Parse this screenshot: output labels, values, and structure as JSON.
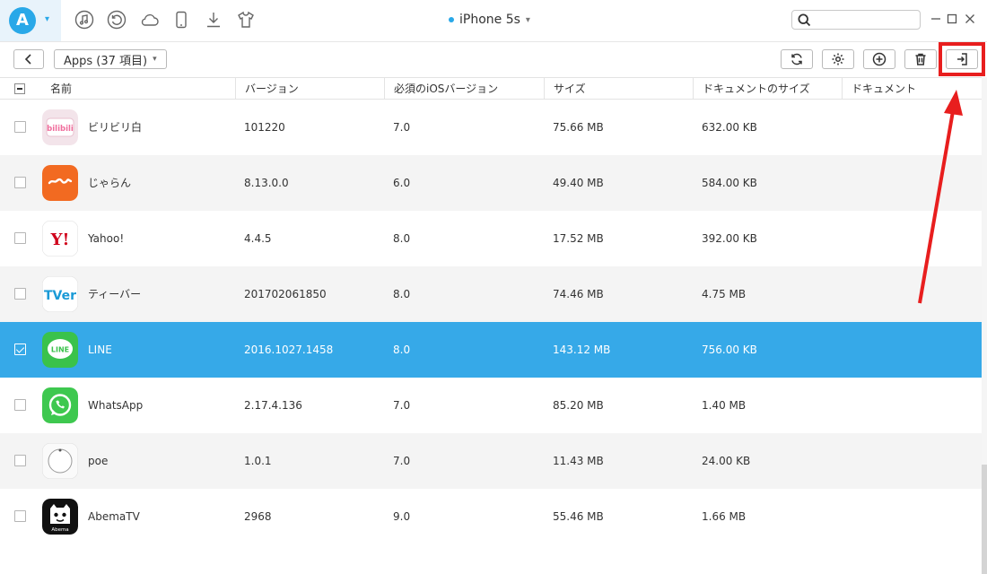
{
  "titlebar": {
    "logo_letter": "A",
    "device_name": "iPhone 5s",
    "search": {
      "value": "",
      "placeholder": ""
    },
    "nav_icons": [
      "music-icon",
      "history-icon",
      "cloud-icon",
      "phone-icon",
      "download-icon",
      "tshirt-icon"
    ]
  },
  "toolbar": {
    "category_label": "Apps (37 項目)",
    "buttons": [
      "refresh-icon",
      "settings-icon",
      "add-icon",
      "trash-icon",
      "export-to-pc-icon"
    ]
  },
  "table": {
    "columns": [
      "名前",
      "バージョン",
      "必須のiOSバージョン",
      "サイズ",
      "ドキュメントのサイズ",
      "ドキュメント"
    ],
    "rows": [
      {
        "name": "ビリビリ白",
        "version": "101220",
        "ios": "7.0",
        "size": "75.66 MB",
        "doc_size": "632.00 KB",
        "selected": false,
        "icon": "bilibili-icon"
      },
      {
        "name": "じゃらん",
        "version": "8.13.0.0",
        "ios": "6.0",
        "size": "49.40 MB",
        "doc_size": "584.00 KB",
        "selected": false,
        "icon": "jalan-icon"
      },
      {
        "name": "Yahoo!",
        "version": "4.4.5",
        "ios": "8.0",
        "size": "17.52 MB",
        "doc_size": "392.00 KB",
        "selected": false,
        "icon": "yahoo-icon"
      },
      {
        "name": "ティーバー",
        "version": "201702061850",
        "ios": "8.0",
        "size": "74.46 MB",
        "doc_size": "4.75 MB",
        "selected": false,
        "icon": "tver-icon"
      },
      {
        "name": "LINE",
        "version": "2016.1027.1458",
        "ios": "8.0",
        "size": "143.12 MB",
        "doc_size": "756.00 KB",
        "selected": true,
        "icon": "line-icon"
      },
      {
        "name": "WhatsApp",
        "version": "2.17.4.136",
        "ios": "7.0",
        "size": "85.20 MB",
        "doc_size": "1.40 MB",
        "selected": false,
        "icon": "whatsapp-icon"
      },
      {
        "name": "poe",
        "version": "1.0.1",
        "ios": "7.0",
        "size": "11.43 MB",
        "doc_size": "24.00 KB",
        "selected": false,
        "icon": "poe-icon"
      },
      {
        "name": "AbemaTV",
        "version": "2968",
        "ios": "9.0",
        "size": "55.46 MB",
        "doc_size": "1.66 MB",
        "selected": false,
        "icon": "abematv-icon"
      }
    ]
  },
  "icon_text": {
    "bilibili": "bilibili",
    "yahoo": "Y!",
    "tver": "TVer",
    "line": "LINE",
    "abema": "Abema"
  },
  "colors": {
    "accent": "#29a8e8",
    "selected_row": "#36a9e8",
    "highlight": "#e81e1e"
  }
}
